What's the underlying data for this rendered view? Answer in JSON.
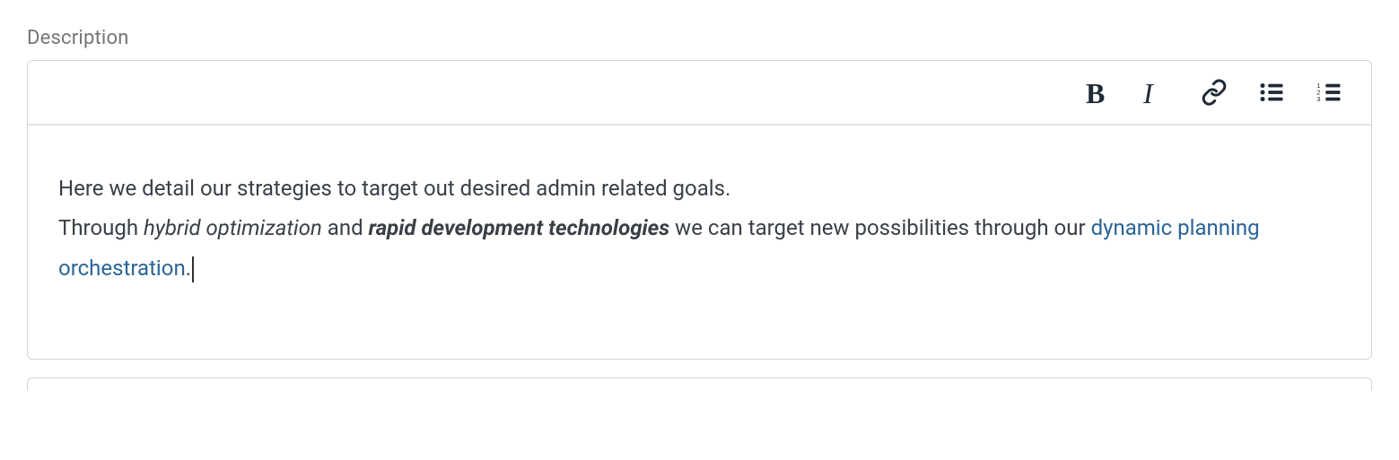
{
  "field": {
    "label": "Description"
  },
  "toolbar": {
    "bold": {
      "name": "bold-button",
      "glyph": "B"
    },
    "italic": {
      "name": "italic-button",
      "glyph": "I"
    },
    "link": {
      "name": "link-button"
    },
    "ul": {
      "name": "bulleted-list-button"
    },
    "ol": {
      "name": "numbered-list-button"
    }
  },
  "content": {
    "line1": "Here we detail our strategies to target out desired admin related goals.",
    "line2_pre": "Through ",
    "line2_em": "hybrid optimization",
    "line2_join": " and ",
    "line2_strongem": "rapid development technologies",
    "line2_post": " we can target new possibilities through our ",
    "line3_link": "dynamic planning orchestration",
    "line3_tail": "."
  },
  "link": {
    "href": "#"
  }
}
